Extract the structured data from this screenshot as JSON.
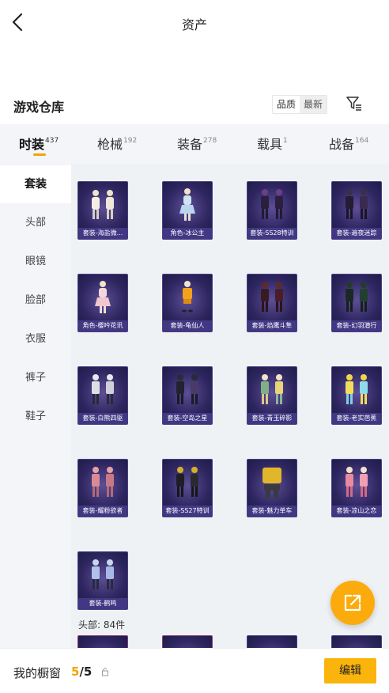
{
  "header": {
    "title": "资产",
    "back_icon": "chevron-left-icon"
  },
  "warehouse": {
    "title": "游戏仓库",
    "sort_options": [
      "品质",
      "最新"
    ],
    "selected_sort": "最新",
    "filter_icon": "filter-icon"
  },
  "tabs": [
    {
      "label": "时装",
      "count": "437",
      "active": true
    },
    {
      "label": "枪械",
      "count": "192",
      "active": false
    },
    {
      "label": "装备",
      "count": "278",
      "active": false
    },
    {
      "label": "载具",
      "count": "1",
      "active": false
    },
    {
      "label": "战备",
      "count": "164",
      "active": false
    }
  ],
  "sidebar": {
    "items": [
      {
        "label": "套装",
        "active": true
      },
      {
        "label": "头部",
        "active": false
      },
      {
        "label": "眼镜",
        "active": false
      },
      {
        "label": "脸部",
        "active": false
      },
      {
        "label": "衣服",
        "active": false
      },
      {
        "label": "裤子",
        "active": false
      },
      {
        "label": "鞋子",
        "active": false
      }
    ]
  },
  "items": [
    "套装-海盐微...",
    "角色-冰公主",
    "套装-SS28特训",
    "套装-遍夜迷踪",
    "角色-樱吟花讯",
    "套装-龟仙人",
    "套装-焰鹰斗隼",
    "套装-幻羽潜行",
    "套装-白熊四驱",
    "套装-空岛之星",
    "套装-青玉碎影",
    "套装-老实芭蕉",
    "套装-耀粉欲者",
    "套装-SS27特训",
    "套装-魅力单车",
    "套装-凉山之恋",
    "套装-鹤鸣"
  ],
  "section_label": "头部: 84件",
  "bottom": {
    "label": "我的橱窗",
    "count_current": "5",
    "count_total": "/5",
    "lock_icon": "lock-icon",
    "edit_label": "编辑"
  },
  "fab_icon": "share-external-icon",
  "colors": {
    "accent": "#f5a300",
    "button": "#fbb40c",
    "card_bg": "#2e2660"
  }
}
